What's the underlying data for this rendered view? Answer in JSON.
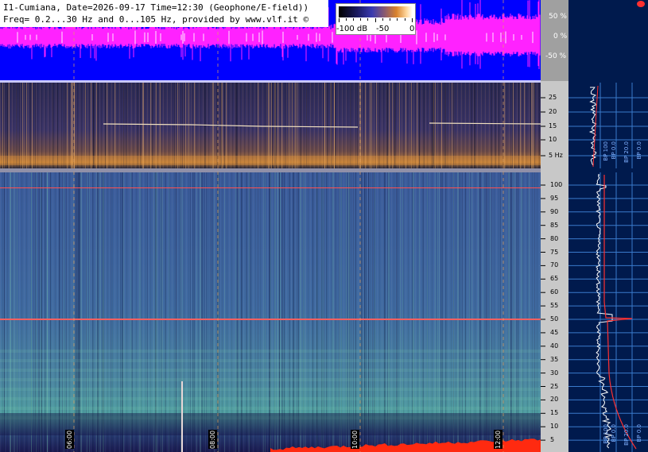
{
  "header": {
    "line1": "I1-Cumiana, Date=2026-09-17 Time=12:30 (Geophone/E-field))",
    "line2": "Freq= 0.2...30 Hz and 0...105 Hz, provided by www.vlf.it ©"
  },
  "colorbar": {
    "labels": [
      "-100 dB",
      "-50",
      "0"
    ]
  },
  "waveform": {
    "percent_labels": [
      "50 %",
      "0 %",
      "-50 %"
    ]
  },
  "low_band": {
    "ticks": [
      "25",
      "20",
      "15",
      "10",
      "5 Hz"
    ],
    "bp_labels": [
      "BP 100",
      "BP 0.0",
      "BP 20.0",
      "BP 0.0"
    ]
  },
  "high_band": {
    "ticks": [
      "100",
      "95",
      "90",
      "85",
      "80",
      "75",
      "70",
      "65",
      "60",
      "55",
      "50",
      "45",
      "40",
      "35",
      "30",
      "25",
      "20",
      "15",
      "10",
      "5"
    ],
    "bp_labels": [
      "BP 100",
      "BP 0.0",
      "BP 20.0",
      "BP 0.0"
    ]
  },
  "time_labels": [
    "06:00",
    "08:00",
    "10:00",
    "12:00"
  ],
  "colors": {
    "waveform_bg": "#0000ff",
    "waveform_trace": "#ff22ff",
    "gutter": "#c8c8c8",
    "panel": "#001a4d",
    "marker": "#ff3030"
  },
  "icons": {
    "record": "record-dot-icon"
  }
}
